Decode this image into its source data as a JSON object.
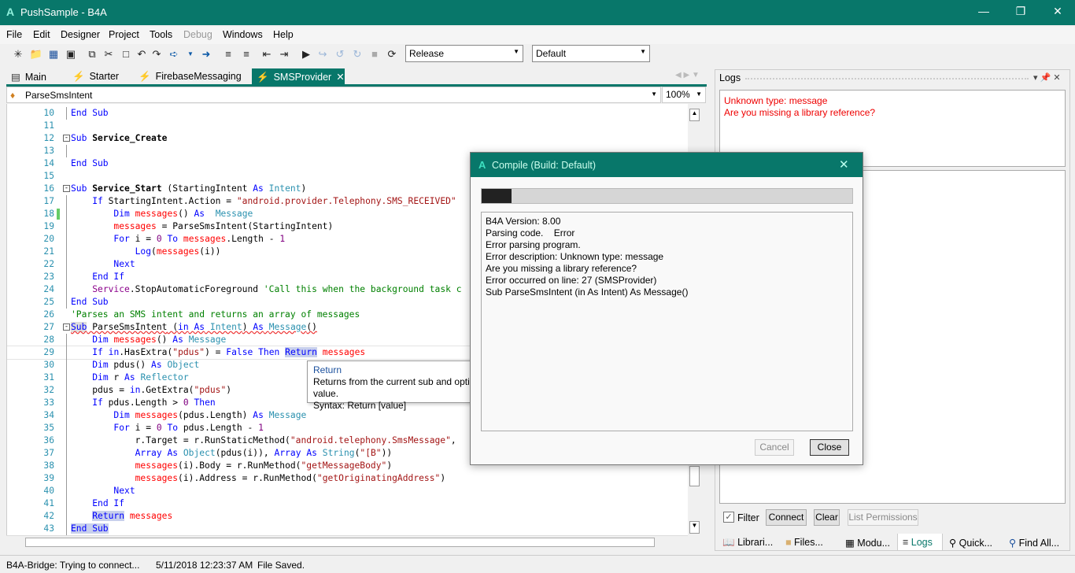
{
  "window": {
    "title": "PushSample - B4A",
    "logo": "A"
  },
  "menu": [
    "File",
    "Edit",
    "Designer",
    "Project",
    "Tools",
    "Debug",
    "Windows",
    "Help"
  ],
  "toolbar": {
    "build_config": "Release",
    "device": "Default"
  },
  "tabs": [
    {
      "label": "Main",
      "icon": "designer-icon"
    },
    {
      "label": "Starter",
      "icon": "service-icon"
    },
    {
      "label": "FirebaseMessaging",
      "icon": "service-icon"
    },
    {
      "label": "SMSProvider",
      "icon": "service-icon",
      "active": true
    }
  ],
  "subs_dropdown": "ParseSmsIntent",
  "zoom": "100%",
  "code": [
    {
      "n": "10",
      "fold": false,
      "t": [
        [
          "End Sub",
          "k"
        ]
      ]
    },
    {
      "n": "11",
      "t": []
    },
    {
      "n": "12",
      "fold": true,
      "t": [
        [
          "Sub",
          "k"
        ],
        [
          " Service_Create",
          "b"
        ]
      ]
    },
    {
      "n": "13",
      "t": []
    },
    {
      "n": "14",
      "t": [
        [
          "End Sub",
          "k"
        ]
      ]
    },
    {
      "n": "15",
      "t": []
    },
    {
      "n": "16",
      "fold": true,
      "t": [
        [
          "Sub",
          "k"
        ],
        [
          " Service_Start",
          "b"
        ],
        [
          " (StartingIntent ",
          ""
        ],
        [
          "As",
          "k"
        ],
        [
          " ",
          ""
        ],
        [
          "Intent",
          "t"
        ],
        [
          ")",
          ""
        ]
      ]
    },
    {
      "n": "17",
      "t": [
        [
          "    ",
          ""
        ],
        [
          "If",
          "k"
        ],
        [
          " StartingIntent.Action = ",
          ""
        ],
        [
          "\"android.provider.Telephony.SMS_RECEIVED\"",
          "s"
        ]
      ]
    },
    {
      "n": "18",
      "changed": true,
      "t": [
        [
          "        ",
          ""
        ],
        [
          "Dim",
          "k"
        ],
        [
          " ",
          ""
        ],
        [
          "messages",
          "v"
        ],
        [
          "() ",
          ""
        ],
        [
          "As",
          "k"
        ],
        [
          "  ",
          ""
        ],
        [
          "Message",
          "t"
        ]
      ]
    },
    {
      "n": "19",
      "t": [
        [
          "        ",
          ""
        ],
        [
          "messages",
          "v"
        ],
        [
          " = ParseSmsIntent(StartingIntent)",
          ""
        ]
      ]
    },
    {
      "n": "20",
      "t": [
        [
          "        ",
          ""
        ],
        [
          "For",
          "k"
        ],
        [
          " i = ",
          ""
        ],
        [
          "0",
          "n"
        ],
        [
          " ",
          ""
        ],
        [
          "To",
          "k"
        ],
        [
          " ",
          ""
        ],
        [
          "messages",
          "v"
        ],
        [
          ".Length - ",
          ""
        ],
        [
          "1",
          "n"
        ]
      ]
    },
    {
      "n": "21",
      "t": [
        [
          "            ",
          ""
        ],
        [
          "Log",
          "k"
        ],
        [
          "(",
          ""
        ],
        [
          "messages",
          "v"
        ],
        [
          "(i))",
          ""
        ]
      ]
    },
    {
      "n": "22",
      "t": [
        [
          "        ",
          ""
        ],
        [
          "Next",
          "k"
        ]
      ]
    },
    {
      "n": "23",
      "t": [
        [
          "    ",
          ""
        ],
        [
          "End If",
          "k"
        ]
      ]
    },
    {
      "n": "24",
      "t": [
        [
          "    ",
          ""
        ],
        [
          "Service",
          "p"
        ],
        [
          ".StopAutomaticForeground ",
          ""
        ],
        [
          "'Call this when the background task c",
          "c"
        ]
      ]
    },
    {
      "n": "25",
      "t": [
        [
          "End Sub",
          "k"
        ]
      ]
    },
    {
      "n": "26",
      "t": [
        [
          "'Parses an SMS intent and returns an array of messages",
          "c"
        ]
      ]
    },
    {
      "n": "27",
      "fold": true,
      "t": [
        [
          "Sub",
          "k"
        ],
        [
          " ParseSmsIntent",
          ""
        ],
        [
          " (",
          ""
        ],
        [
          "in",
          "k"
        ],
        [
          " ",
          ""
        ],
        [
          "As",
          "k"
        ],
        [
          " ",
          ""
        ],
        [
          "Intent",
          "t"
        ],
        [
          ") ",
          ""
        ],
        [
          "As",
          "k"
        ],
        [
          " ",
          ""
        ],
        [
          "Message",
          "t"
        ],
        [
          "()",
          ""
        ]
      ]
    },
    {
      "n": "28",
      "t": [
        [
          "    ",
          ""
        ],
        [
          "Dim",
          "k"
        ],
        [
          " ",
          ""
        ],
        [
          "messages",
          "v"
        ],
        [
          "() ",
          ""
        ],
        [
          "As",
          "k"
        ],
        [
          " ",
          ""
        ],
        [
          "Message",
          "t"
        ]
      ]
    },
    {
      "n": "29",
      "t": [
        [
          "    ",
          ""
        ],
        [
          "If",
          "k"
        ],
        [
          " ",
          ""
        ],
        [
          "in",
          "k"
        ],
        [
          ".HasExtra(",
          ""
        ],
        [
          "\"pdus\"",
          "s"
        ],
        [
          ") = ",
          ""
        ],
        [
          "False",
          "k"
        ],
        [
          " ",
          ""
        ],
        [
          "Then",
          "k"
        ],
        [
          " ",
          ""
        ],
        [
          "Return",
          "k"
        ],
        [
          " ",
          ""
        ],
        [
          "messages",
          "v"
        ]
      ]
    },
    {
      "n": "30",
      "t": [
        [
          "    ",
          ""
        ],
        [
          "Dim",
          "k"
        ],
        [
          " pdus() ",
          ""
        ],
        [
          "As",
          "k"
        ],
        [
          " ",
          ""
        ],
        [
          "Object",
          "t"
        ]
      ]
    },
    {
      "n": "31",
      "t": [
        [
          "    ",
          ""
        ],
        [
          "Dim",
          "k"
        ],
        [
          " r ",
          ""
        ],
        [
          "As",
          "k"
        ],
        [
          " ",
          ""
        ],
        [
          "Reflector",
          "t"
        ]
      ]
    },
    {
      "n": "32",
      "t": [
        [
          "    pdus = ",
          ""
        ],
        [
          "in",
          "k"
        ],
        [
          ".GetExtra(",
          ""
        ],
        [
          "\"pdus\"",
          "s"
        ],
        [
          ")",
          ""
        ]
      ]
    },
    {
      "n": "33",
      "t": [
        [
          "    ",
          ""
        ],
        [
          "If",
          "k"
        ],
        [
          " pdus.Length > ",
          ""
        ],
        [
          "0",
          "n"
        ],
        [
          " ",
          ""
        ],
        [
          "Then",
          "k"
        ]
      ]
    },
    {
      "n": "34",
      "t": [
        [
          "        ",
          ""
        ],
        [
          "Dim",
          "k"
        ],
        [
          " ",
          ""
        ],
        [
          "messages",
          "v"
        ],
        [
          "(pdus.Length) ",
          ""
        ],
        [
          "As",
          "k"
        ],
        [
          " ",
          ""
        ],
        [
          "Message",
          "t"
        ]
      ]
    },
    {
      "n": "35",
      "t": [
        [
          "        ",
          ""
        ],
        [
          "For",
          "k"
        ],
        [
          " i = ",
          ""
        ],
        [
          "0",
          "n"
        ],
        [
          " ",
          ""
        ],
        [
          "To",
          "k"
        ],
        [
          " pdus.Length - ",
          ""
        ],
        [
          "1",
          "n"
        ]
      ]
    },
    {
      "n": "36",
      "t": [
        [
          "            r.Target = r.RunStaticMethod(",
          ""
        ],
        [
          "\"android.telephony.SmsMessage\"",
          "s"
        ],
        [
          ",",
          ""
        ]
      ]
    },
    {
      "n": "37",
      "t": [
        [
          "            ",
          ""
        ],
        [
          "Array",
          "k"
        ],
        [
          " ",
          ""
        ],
        [
          "As",
          "k"
        ],
        [
          " ",
          ""
        ],
        [
          "Object",
          "t"
        ],
        [
          "(pdus(i)), ",
          ""
        ],
        [
          "Array",
          "k"
        ],
        [
          " ",
          ""
        ],
        [
          "As",
          "k"
        ],
        [
          " ",
          ""
        ],
        [
          "String",
          "t"
        ],
        [
          "(",
          ""
        ],
        [
          "\"[B\"",
          "s"
        ],
        [
          "))",
          ""
        ]
      ]
    },
    {
      "n": "38",
      "t": [
        [
          "            ",
          ""
        ],
        [
          "messages",
          "v"
        ],
        [
          "(i).Body = r.RunMethod(",
          ""
        ],
        [
          "\"getMessageBody\"",
          "s"
        ],
        [
          ")",
          ""
        ]
      ]
    },
    {
      "n": "39",
      "t": [
        [
          "            ",
          ""
        ],
        [
          "messages",
          "v"
        ],
        [
          "(i).Address = r.RunMethod(",
          ""
        ],
        [
          "\"getOriginatingAddress\"",
          "s"
        ],
        [
          ")",
          ""
        ]
      ]
    },
    {
      "n": "40",
      "t": [
        [
          "        ",
          ""
        ],
        [
          "Next",
          "k"
        ]
      ]
    },
    {
      "n": "41",
      "t": [
        [
          "    ",
          ""
        ],
        [
          "End If",
          "k"
        ]
      ]
    },
    {
      "n": "42",
      "t": [
        [
          "    ",
          ""
        ],
        [
          "Return",
          "k"
        ],
        [
          " ",
          ""
        ],
        [
          "messages",
          "v"
        ]
      ]
    },
    {
      "n": "43",
      "t": [
        [
          "End Sub",
          "k"
        ]
      ]
    }
  ],
  "tooltip": {
    "title": "Return",
    "description": "Returns from the current sub and optionally returns the given value.",
    "syntax": "Syntax: Return [value]"
  },
  "logs": {
    "title": "Logs",
    "lines": [
      "Unknown type: message",
      "Are you missing a library reference?"
    ],
    "filter_label": "Filter",
    "filter_checked": true,
    "connect": "Connect",
    "clear": "Clear",
    "list_permissions": "List Permissions"
  },
  "bottom_tabs": [
    {
      "label": "Librari...",
      "icon": "book-icon"
    },
    {
      "label": "Files...",
      "icon": "folder-icon"
    },
    {
      "label": "Modu...",
      "icon": "modules-icon"
    },
    {
      "label": "Logs",
      "icon": "logs-icon",
      "active": true
    },
    {
      "label": "Quick...",
      "icon": "search-icon"
    },
    {
      "label": "Find All...",
      "icon": "find-all-icon"
    }
  ],
  "status": {
    "bridge": "B4A-Bridge: Trying to connect...",
    "time": "5/11/2018 12:23:37 AM",
    "message": "File Saved."
  },
  "dialog": {
    "title": "Compile (Build: Default)",
    "progress_percent": 8,
    "output": [
      "B4A Version: 8.00",
      "Parsing code.    Error",
      "Error parsing program.",
      "Error description: Unknown type: message",
      "Are you missing a library reference?",
      "Error occurred on line: 27 (SMSProvider)",
      "Sub ParseSmsIntent (in As Intent) As Message()"
    ],
    "cancel": "Cancel",
    "close": "Close"
  },
  "colors": {
    "accent": "#08776a",
    "error": "#ee0000"
  }
}
